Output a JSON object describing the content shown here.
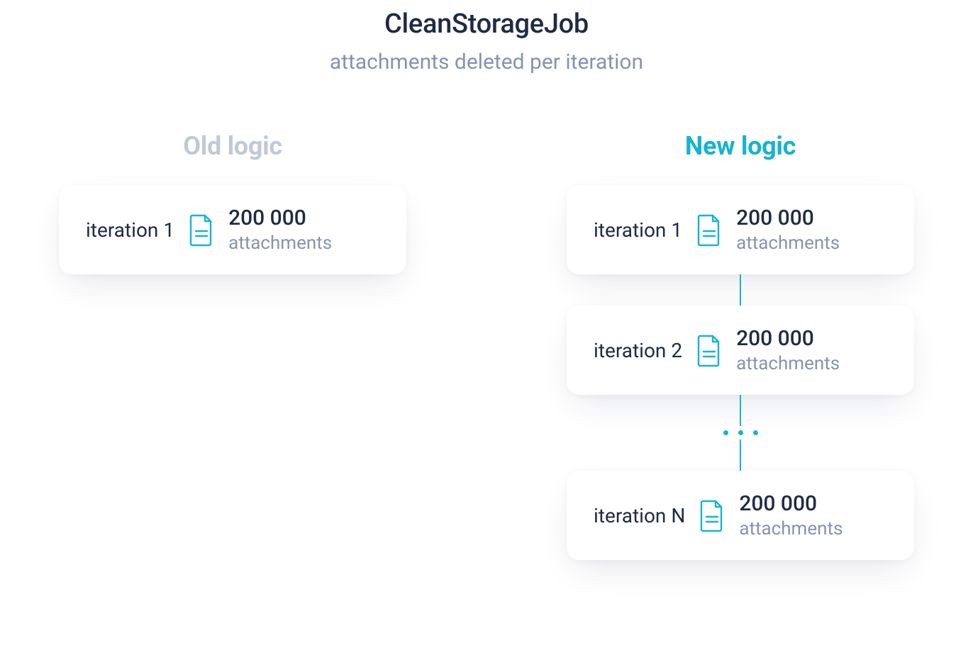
{
  "header": {
    "title": "CleanStorageJob",
    "subtitle": "attachments deleted per iteration"
  },
  "columns": {
    "old": {
      "title": "Old logic",
      "cards": [
        {
          "label": "iteration 1",
          "value": "200 000",
          "unit": "attachments"
        }
      ]
    },
    "new": {
      "title": "New logic",
      "cards": [
        {
          "label": "iteration 1",
          "value": "200 000",
          "unit": "attachments"
        },
        {
          "label": "iteration 2",
          "value": "200 000",
          "unit": "attachments"
        },
        {
          "label": "iteration N",
          "value": "200 000",
          "unit": "attachments"
        }
      ]
    }
  },
  "colors": {
    "accent": "#17b4cf",
    "muted": "#c2c8d7",
    "text": "#1f2a44",
    "subtext": "#8892b0"
  }
}
